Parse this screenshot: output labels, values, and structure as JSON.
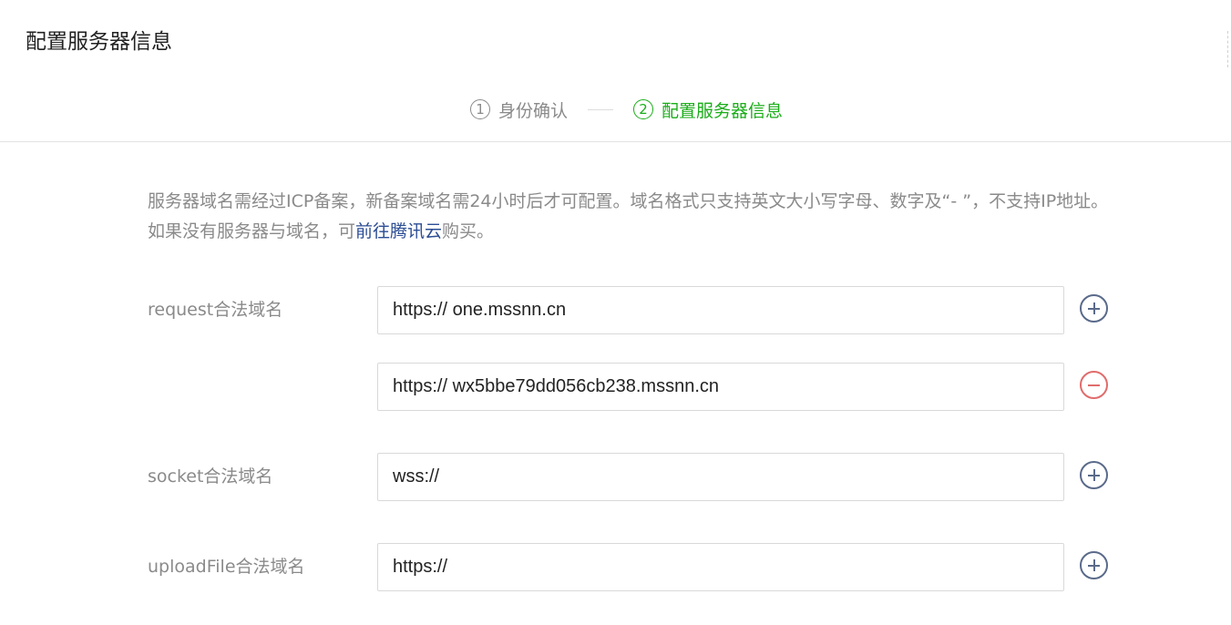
{
  "dialog": {
    "title": "配置服务器信息"
  },
  "steps": [
    {
      "number": "1",
      "label": "身份确认",
      "active": false
    },
    {
      "number": "2",
      "label": "配置服务器信息",
      "active": true
    }
  ],
  "notice": {
    "text_before_link": "服务器域名需经过ICP备案，新备案域名需24小时后才可配置。域名格式只支持英文大小写字母、数字及“- ”，不支持IP地址。如果没有服务器与域名，可",
    "link_text": "前往腾讯云",
    "text_after_link": "购买。"
  },
  "fields": {
    "request": {
      "label": "request合法域名",
      "values": [
        "https:// one.mssnn.cn",
        "https:// wx5bbe79dd056cb238.mssnn.cn"
      ]
    },
    "socket": {
      "label": "socket合法域名",
      "value": "wss://"
    },
    "upload": {
      "label": "uploadFile合法域名",
      "value": "https://"
    }
  },
  "icons": {
    "add": "plus-circle-icon",
    "remove": "minus-circle-icon"
  },
  "colors": {
    "active_step": "#1aad19",
    "inactive_step": "#8a8a8a",
    "link": "#2b4d94",
    "add_icon": "#5a6a8a",
    "remove_icon": "#e06c6c"
  }
}
